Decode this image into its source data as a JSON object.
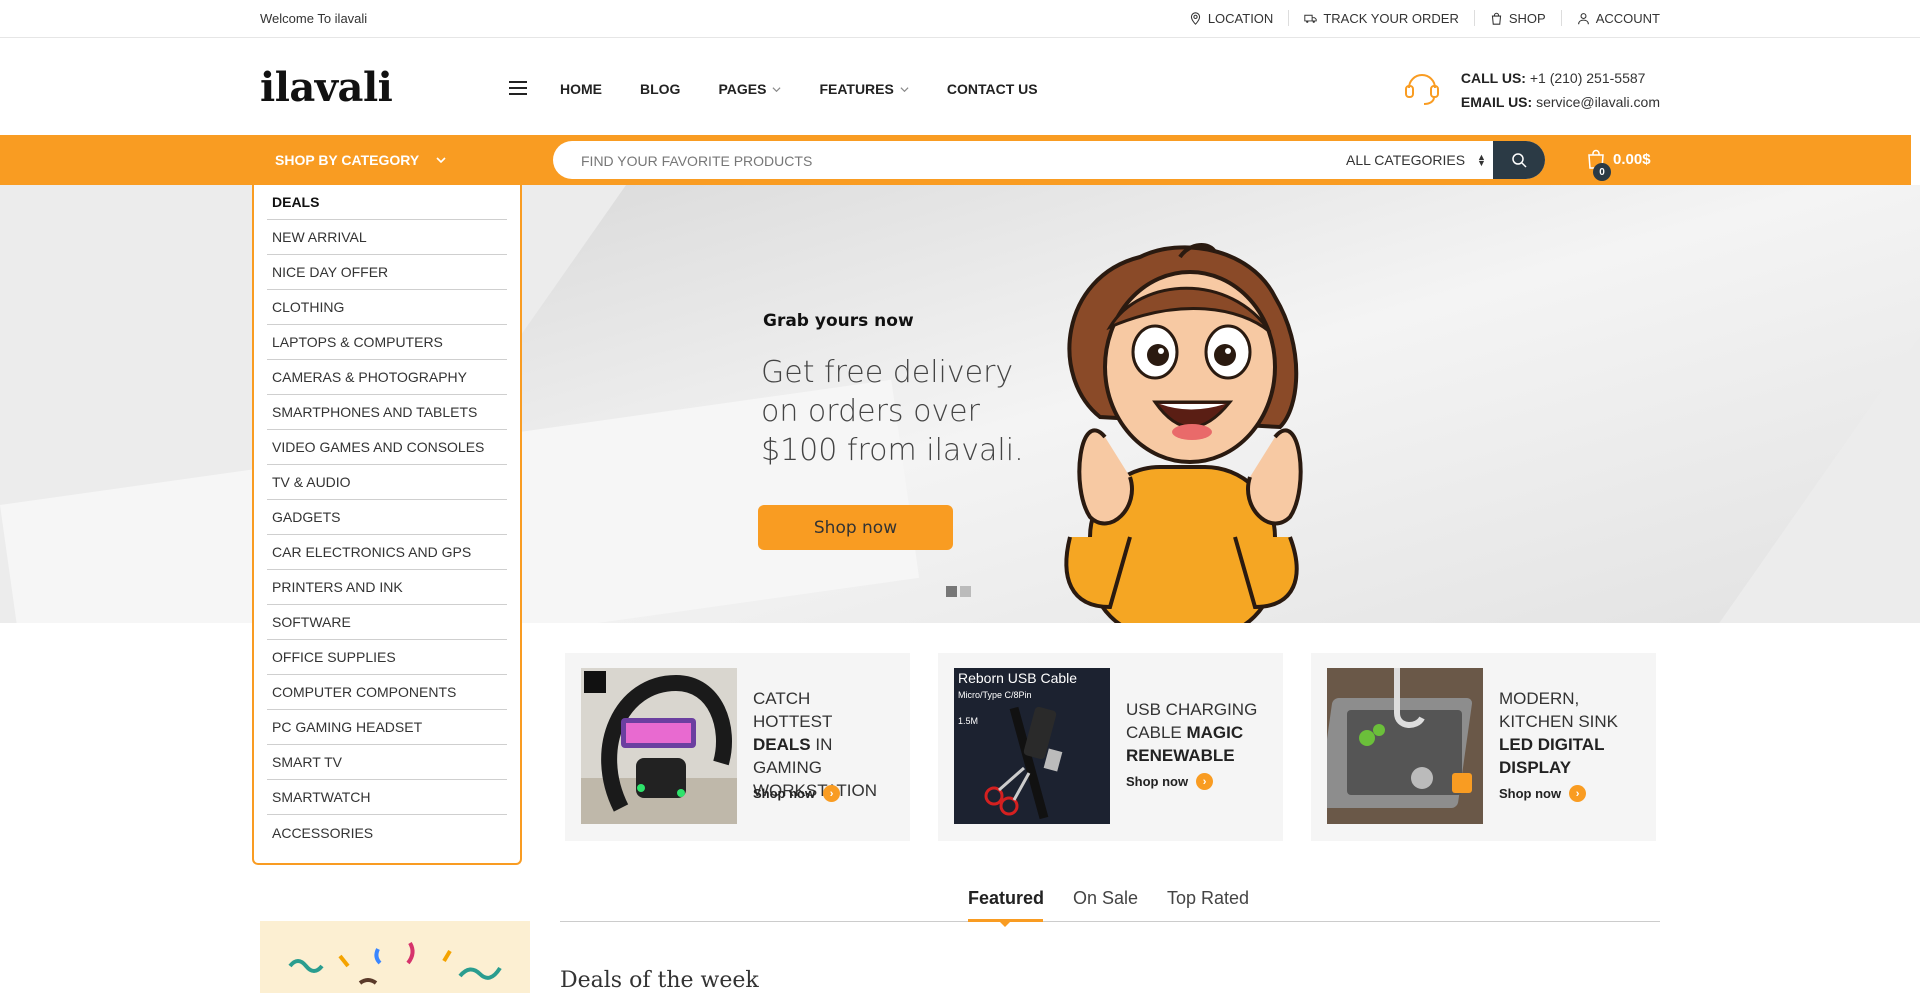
{
  "topbar": {
    "welcome": "Welcome To ilavali",
    "links": [
      {
        "label": "LOCATION",
        "icon": "location-pin-icon"
      },
      {
        "label": "TRACK YOUR ORDER",
        "icon": "truck-icon"
      },
      {
        "label": "SHOP",
        "icon": "shopping-bag-icon"
      },
      {
        "label": "ACCOUNT",
        "icon": "user-icon"
      }
    ]
  },
  "header": {
    "logo": "ilavali",
    "nav": [
      {
        "label": "HOME"
      },
      {
        "label": "BLOG"
      },
      {
        "label": "PAGES"
      },
      {
        "label": "FEATURES"
      },
      {
        "label": "CONTACT US"
      }
    ],
    "support": {
      "call_label": "CALL US:",
      "call_value": "+1 (210) 251-5587",
      "email_label": "EMAIL US:",
      "email_value": "service@ilavali.com"
    }
  },
  "bar": {
    "shop_by_category": "SHOP BY CATEGORY",
    "search_placeholder": "FIND YOUR FAVORITE PRODUCTS",
    "category_select": "ALL CATEGORIES",
    "cart_count": "0",
    "cart_total": "0.00$"
  },
  "categories": [
    "DEALS",
    "NEW ARRIVAL",
    "NICE DAY OFFER",
    "CLOTHING",
    "LAPTOPS & COMPUTERS",
    "CAMERAS & PHOTOGRAPHY",
    "SMARTPHONES AND TABLETS",
    "VIDEO GAMES AND CONSOLES",
    "TV & AUDIO",
    "GADGETS",
    "CAR ELECTRONICS AND GPS",
    "PRINTERS AND INK",
    "SOFTWARE",
    "OFFICE SUPPLIES",
    "COMPUTER COMPONENTS",
    "PC GAMING HEADSET",
    "SMART TV",
    "SMARTWATCH",
    "ACCESSORIES"
  ],
  "hero": {
    "kicker": "Grab yours now",
    "headline": "Get free delivery on orders over $100 from ilavali.",
    "cta": "Shop now",
    "slides_total": 2,
    "active_slide": 1
  },
  "promos": [
    {
      "plain": "CATCH HOTTEST",
      "bold": "DEALS",
      "plain2": "IN GAMING WORKSTATION",
      "cta": "Shop now"
    },
    {
      "plain": "USB CHARGING CABLE",
      "bold": "MAGIC RENEWABLE",
      "plain2": "",
      "cta": "Shop now",
      "img_title": "Reborn USB Cable",
      "img_sub": "Micro/Type C/8Pin",
      "img_len": "1.5M"
    },
    {
      "plain": "MODERN, KITCHEN SINK",
      "bold": "LED DIGITAL DISPLAY",
      "plain2": "",
      "cta": "Shop now"
    }
  ],
  "tabs": [
    "Featured",
    "On Sale",
    "Top Rated"
  ],
  "deals_title": "Deals of the week",
  "colors": {
    "accent": "#f99c22",
    "dark": "#2b3a45"
  }
}
